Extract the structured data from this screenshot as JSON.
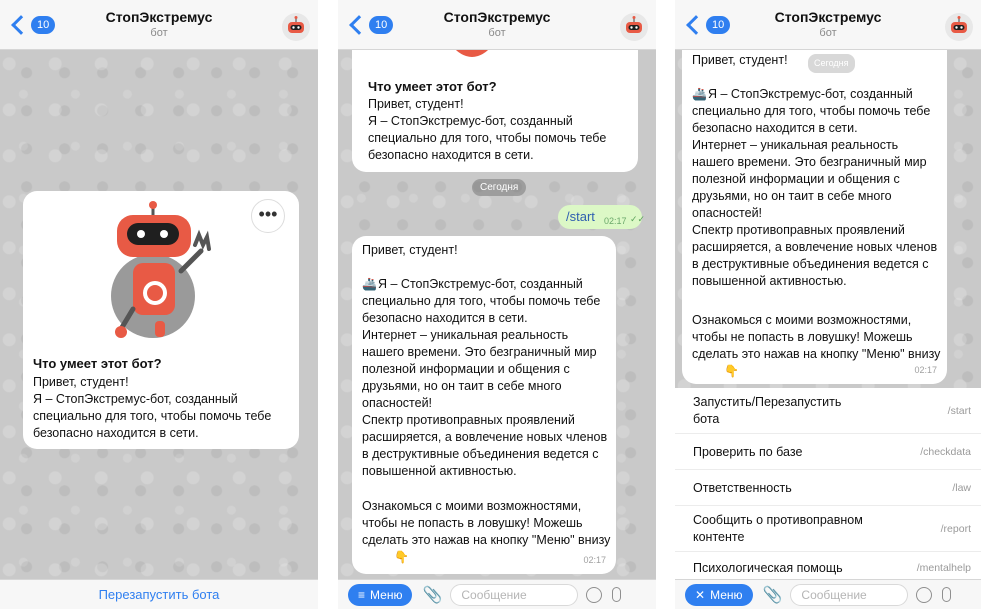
{
  "header": {
    "back_count": "10",
    "title": "СтопЭкстремус",
    "subtitle": "бот"
  },
  "intro_card": {
    "heading": "Что умеет этот бот?",
    "body": "Привет, студент!\nЯ – СтопЭкстремус-бот, созданный специально для того, чтобы помочь тебе безопасно находится в сети."
  },
  "screen1": {
    "restart_label": "Перезапустить бота"
  },
  "screen2": {
    "date_label": "Сегодня",
    "start_message": "/start",
    "start_time": "02:17",
    "reply_greeting": "Привет, студент!",
    "reply_body": "Я – СтопЭкстремус-бот, созданный специально для того, чтобы помочь тебе безопасно находится в сети.\nИнтернет – уникальная реальность нашего времени. Это безграничный мир полезной информации и общения с друзьями, но он таит в себе много опасностей!\nСпектр противоправных проявлений расширяется, а вовлечение новых членов в деструктивные объединения ведется с повышенной активностью.",
    "reply_outro": "Ознакомься с моими возможностями, чтобы не попасть в ловушку! Можешь сделать это нажав на кнопку \"Меню\" внизу",
    "reply_time": "02:17"
  },
  "composer": {
    "menu_label": "Меню",
    "placeholder": "Сообщение"
  },
  "screen3": {
    "greeting": "Привет, студент!",
    "date_label": "Сегодня",
    "time": "02:17",
    "commands": [
      {
        "label": "Запустить/Перезапустить бота",
        "code": "/start"
      },
      {
        "label": "Проверить по базе",
        "code": "/checkdata"
      },
      {
        "label": "Ответственность",
        "code": "/law"
      },
      {
        "label": "Сообщить о противоправном контенте",
        "code": "/report"
      },
      {
        "label": "Психологическая помощь",
        "code": "/mentalhelp"
      }
    ]
  },
  "icons": {
    "back": "chevron-left-icon",
    "avatar": "robot-avatar-icon",
    "menu": "hamburger-icon",
    "close": "close-icon",
    "attach": "paperclip-icon",
    "sticker": "sticker-icon",
    "mic": "microphone-icon",
    "more": "more-dots-icon",
    "point": "point-down-emoji",
    "ship": "ship-emoji",
    "check": "double-check-icon"
  },
  "colors": {
    "accent": "#2f7ff0",
    "bot_red": "#e85a45",
    "outgoing_bubble": "#dcf8c6"
  }
}
